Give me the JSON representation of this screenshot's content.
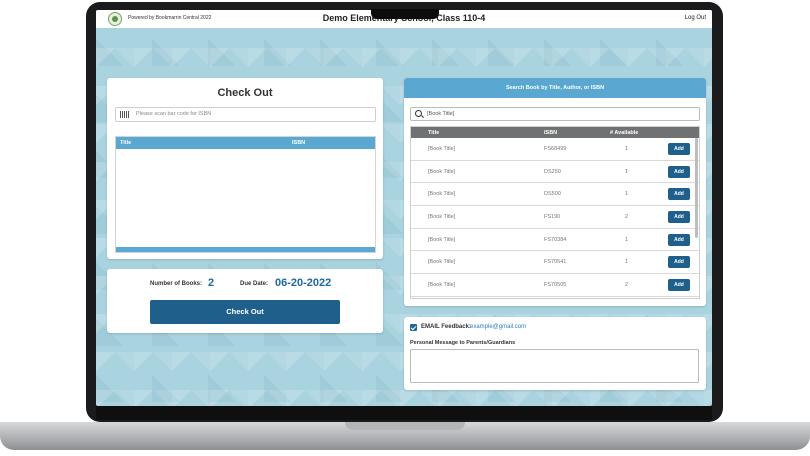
{
  "header": {
    "powered_by": "Powered by Bookmarrin Central 2022",
    "school_title": "Demo Elementary School, Class 110-4",
    "logout_label": "Log Out"
  },
  "checkout": {
    "title": "Check Out",
    "scan_placeholder": "Please scan bar code for ISBN",
    "columns": [
      "Title",
      "ISBN"
    ]
  },
  "summary": {
    "books_label": "Number of Books:",
    "books_value": "2",
    "due_label": "Due Date:",
    "due_value": "06-20-2022",
    "checkout_button": "Check Out"
  },
  "search": {
    "header": "Search Book by Title, Author, or ISBN",
    "query": "[Book Title]",
    "columns": [
      "Title",
      "ISBN",
      "# Available"
    ],
    "add_label": "Add",
    "rows": [
      {
        "title": "[Book Title]",
        "isbn": "FS68499",
        "available": "1"
      },
      {
        "title": "[Book Title]",
        "isbn": "DS250",
        "available": "1"
      },
      {
        "title": "[Book Title]",
        "isbn": "DS500",
        "available": "1"
      },
      {
        "title": "[Book Title]",
        "isbn": "FS190",
        "available": "2"
      },
      {
        "title": "[Book Title]",
        "isbn": "FS70384",
        "available": "1"
      },
      {
        "title": "[Book Title]",
        "isbn": "FS70541",
        "available": "1"
      },
      {
        "title": "[Book Title]",
        "isbn": "FS70505",
        "available": "2"
      }
    ]
  },
  "feedback": {
    "email_label": "EMAIL Feedback:",
    "email_value": "example@gmail.com",
    "message_label": "Personal Message to Parents/Guardians"
  },
  "colors": {
    "accent": "#5aa7d1",
    "button": "#1e5f8b",
    "background": "#a9d3df"
  }
}
